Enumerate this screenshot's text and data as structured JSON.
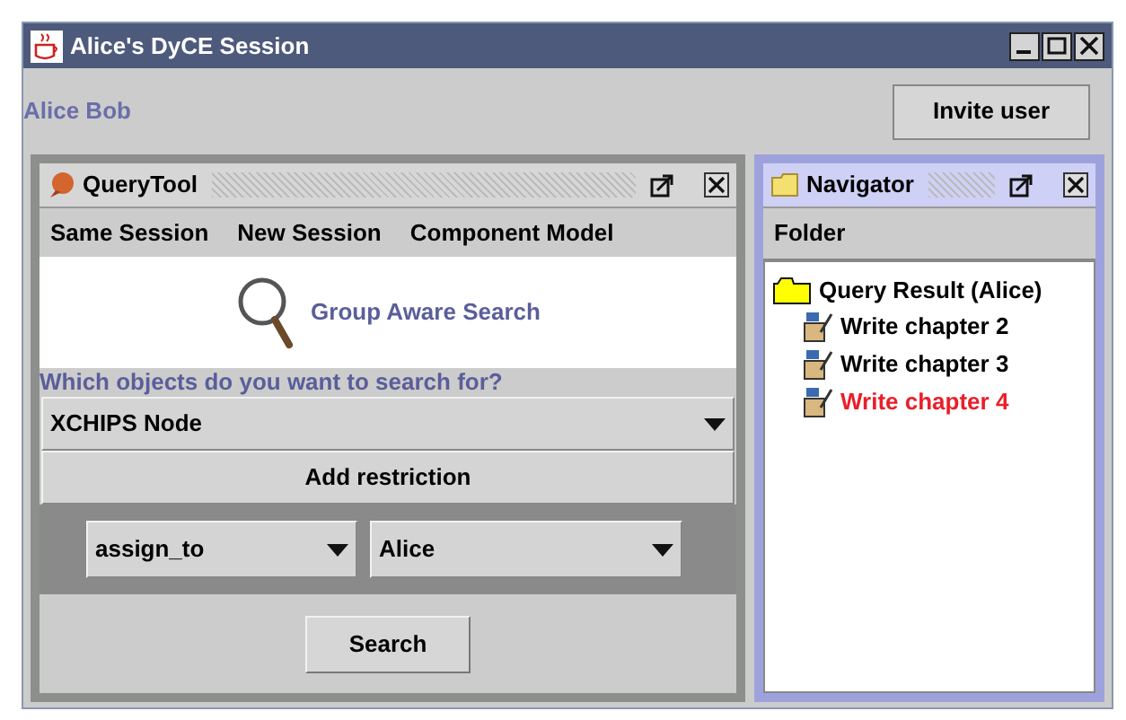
{
  "window": {
    "title": "Alice's DyCE Session"
  },
  "users": "Alice Bob",
  "invite_button": "Invite user",
  "query_tool": {
    "title": "QueryTool",
    "active": false,
    "menu": [
      "Same Session",
      "New Session",
      "Component Model"
    ],
    "banner": "Group Aware Search",
    "question": "Which objects do you want to search for?",
    "object_type": "XCHIPS Node",
    "add_button": "Add restriction",
    "restriction": {
      "attribute": "assign_to",
      "value": "Alice"
    },
    "search_button": "Search"
  },
  "navigator": {
    "title": "Navigator",
    "active": true,
    "header": "Folder",
    "tree": {
      "label": "Query Result  (Alice)",
      "children": [
        {
          "label": "Write chapter 2",
          "color": "#000000"
        },
        {
          "label": "Write chapter 3",
          "color": "#000000"
        },
        {
          "label": "Write chapter 4",
          "color": "#e8202a"
        }
      ]
    }
  }
}
